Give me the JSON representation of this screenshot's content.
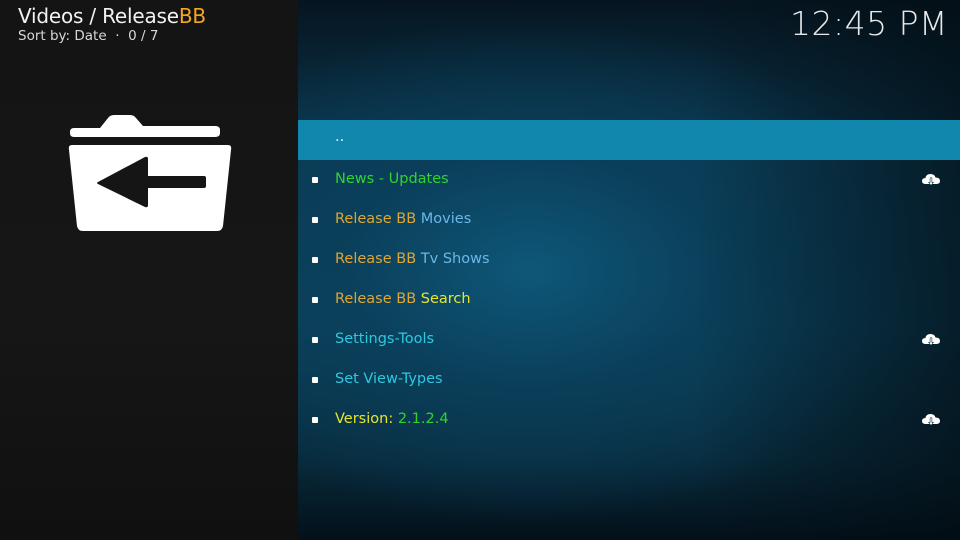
{
  "header": {
    "title_prefix": "Videos / Release",
    "title_accent": "BB",
    "sort_label": "Sort by: Date",
    "separator": "·",
    "position": "0 / 7"
  },
  "clock": "12:45 PM",
  "colors": {
    "accent_orange": "#f5a623",
    "selection": "#1287ad",
    "green": "#2fd52f",
    "gold": "#e0a630",
    "light_blue": "#6ab8e8",
    "yellow": "#e6e62e",
    "cyan": "#2ec8e0"
  },
  "sidebar": {
    "icon": "folder-back-icon"
  },
  "list": {
    "items": [
      {
        "segments": [
          {
            "text": "..",
            "color": "#e8f4f8"
          }
        ],
        "selected": true,
        "bullet": false,
        "cloud": false
      },
      {
        "segments": [
          {
            "text": "News - Updates",
            "color": "#2fd52f"
          }
        ],
        "selected": false,
        "bullet": true,
        "cloud": true,
        "cloud_icon": "cloud-download-icon"
      },
      {
        "segments": [
          {
            "text": "Release BB ",
            "color": "#e0a630"
          },
          {
            "text": "Movies",
            "color": "#6ab8e8"
          }
        ],
        "selected": false,
        "bullet": true,
        "cloud": false
      },
      {
        "segments": [
          {
            "text": "Release BB ",
            "color": "#e0a630"
          },
          {
            "text": "Tv Shows",
            "color": "#6ab8e8"
          }
        ],
        "selected": false,
        "bullet": true,
        "cloud": false
      },
      {
        "segments": [
          {
            "text": "Release BB ",
            "color": "#e0a630"
          },
          {
            "text": "Search",
            "color": "#e6e62e"
          }
        ],
        "selected": false,
        "bullet": true,
        "cloud": false
      },
      {
        "segments": [
          {
            "text": "Settings-Tools",
            "color": "#2ec8e0"
          }
        ],
        "selected": false,
        "bullet": true,
        "cloud": true,
        "cloud_icon": "cloud-download-icon"
      },
      {
        "segments": [
          {
            "text": "Set View-Types",
            "color": "#2ec8e0"
          }
        ],
        "selected": false,
        "bullet": true,
        "cloud": false
      },
      {
        "segments": [
          {
            "text": "Version: ",
            "color": "#e6e62e"
          },
          {
            "text": "2.1.2.4",
            "color": "#2fd52f"
          }
        ],
        "selected": false,
        "bullet": true,
        "cloud": true,
        "cloud_icon": "cloud-download-icon"
      }
    ]
  }
}
